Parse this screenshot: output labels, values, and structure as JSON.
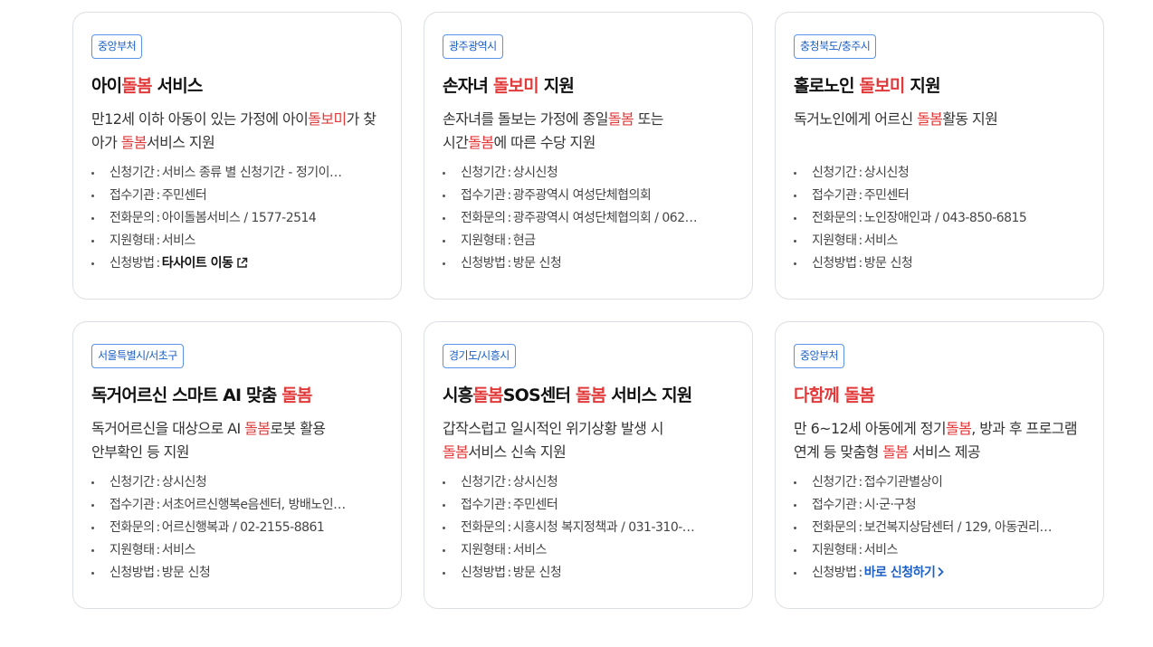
{
  "labels": {
    "apply_period": "신청기간",
    "office": "접수기관",
    "phone": "전화문의",
    "support_type": "지원형태",
    "method": "신청방법",
    "sep": ":"
  },
  "cards": [
    {
      "region": "중앙부처",
      "title": [
        {
          "t": "아이"
        },
        {
          "t": "돌봄",
          "h": true
        },
        {
          "t": " 서비스"
        }
      ],
      "desc": [
        {
          "t": "만12세 이하 아동이 있는 가정에 아이"
        },
        {
          "t": "돌보미",
          "h": true
        },
        {
          "t": "가 찾아가 "
        },
        {
          "t": "돌봄",
          "h": true
        },
        {
          "t": "서비스 지원"
        }
      ],
      "apply_period": "서비스 종류 별 신청기간 - 정기이…",
      "office": "주민센터",
      "phone": "아이돌봄서비스 / 1577-2514",
      "support_type": "서비스",
      "method": "타사이트 이동",
      "method_style": "external"
    },
    {
      "region": "광주광역시",
      "title": [
        {
          "t": "손자녀 "
        },
        {
          "t": "돌보미",
          "h": true
        },
        {
          "t": " 지원"
        }
      ],
      "desc": [
        {
          "t": "손자녀를 돌보는 가정에 종일"
        },
        {
          "t": "돌봄",
          "h": true
        },
        {
          "t": " 또는"
        },
        {
          "br": true
        },
        {
          "t": "시간"
        },
        {
          "t": "돌봄",
          "h": true
        },
        {
          "t": "에 따른 수당 지원"
        }
      ],
      "apply_period": "상시신청",
      "office": "광주광역시 여성단체협의회",
      "phone": "광주광역시 여성단체협의회 / 062…",
      "support_type": "현금",
      "method": "방문 신청",
      "method_style": "plain"
    },
    {
      "region": "충청북도/충주시",
      "title": [
        {
          "t": "홀로노인 "
        },
        {
          "t": "돌보미",
          "h": true
        },
        {
          "t": " 지원"
        }
      ],
      "desc": [
        {
          "t": "독거노인에게 어르신 "
        },
        {
          "t": "돌봄",
          "h": true
        },
        {
          "t": "활동 지원"
        }
      ],
      "apply_period": "상시신청",
      "office": "주민센터",
      "phone": "노인장애인과 / 043-850-6815",
      "support_type": "서비스",
      "method": "방문 신청",
      "method_style": "plain"
    },
    {
      "region": "서울특별시/서초구",
      "title": [
        {
          "t": "독거어르신 스마트 AI 맞춤 "
        },
        {
          "t": "돌봄",
          "h": true
        }
      ],
      "desc": [
        {
          "t": "독거어르신을 대상으로 AI "
        },
        {
          "t": "돌봄",
          "h": true
        },
        {
          "t": "로봇 활용"
        },
        {
          "br": true
        },
        {
          "t": "안부확인 등 지원"
        }
      ],
      "apply_period": "상시신청",
      "office": "서초어르신행복e음센터, 방배노인…",
      "phone": "어르신행복과 / 02-2155-8861",
      "support_type": "서비스",
      "method": "방문 신청",
      "method_style": "plain"
    },
    {
      "region": "경기도/시흥시",
      "title": [
        {
          "t": "시흥"
        },
        {
          "t": "돌봄",
          "h": true
        },
        {
          "t": "SOS센터 "
        },
        {
          "t": "돌봄",
          "h": true
        },
        {
          "t": " 서비스 지원"
        }
      ],
      "desc": [
        {
          "t": "갑작스럽고 일시적인 위기상황 발생 시"
        },
        {
          "br": true
        },
        {
          "t": "돌봄",
          "h": true
        },
        {
          "t": "서비스 신속 지원"
        }
      ],
      "apply_period": "상시신청",
      "office": "주민센터",
      "phone": "시흥시청 복지정책과 / 031-310-…",
      "support_type": "서비스",
      "method": "방문 신청",
      "method_style": "plain"
    },
    {
      "region": "중앙부처",
      "title": [
        {
          "t": "다함께 돌봄",
          "h": true
        }
      ],
      "desc": [
        {
          "t": "만 6~12세 아동에게 정기"
        },
        {
          "t": "돌봄",
          "h": true
        },
        {
          "t": ", 방과 후 프로그램"
        },
        {
          "br": true
        },
        {
          "t": "연계 등 맞춤형 "
        },
        {
          "t": "돌봄",
          "h": true
        },
        {
          "t": " 서비스 제공"
        }
      ],
      "apply_period": "접수기관별상이",
      "office": "시·군·구청",
      "phone": "보건복지상담센터 / 129, 아동권리…",
      "support_type": "서비스",
      "method": "바로 신청하기",
      "method_style": "apply"
    }
  ]
}
